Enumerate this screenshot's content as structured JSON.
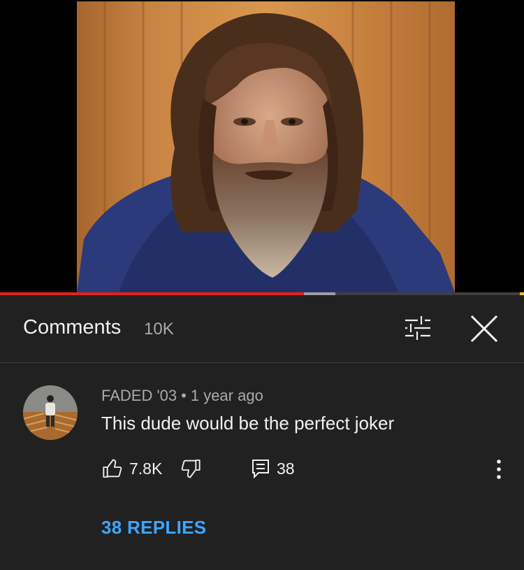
{
  "player": {
    "played_fraction": 0.58,
    "buffered_fraction": 0.64,
    "progress_color": "#e62117",
    "buffer_color": "#9e9e9e"
  },
  "comments_panel": {
    "title": "Comments",
    "count": "10K",
    "filter_icon": "sort-filter-icon",
    "close_icon": "close-icon"
  },
  "comment": {
    "author": "FADED '03",
    "separator": "•",
    "time": "1 year ago",
    "text": "This dude would be the perfect joker",
    "like_count": "7.8K",
    "reply_count": "38",
    "replies_link": "38 REPLIES",
    "icons": {
      "like": "thumbs-up-icon",
      "dislike": "thumbs-down-icon",
      "reply": "comment-icon",
      "more": "more-vertical-icon"
    }
  },
  "colors": {
    "background": "#212121",
    "text_primary": "#f1f1f1",
    "text_secondary": "#aaaaaa",
    "link": "#3ea6ff"
  }
}
